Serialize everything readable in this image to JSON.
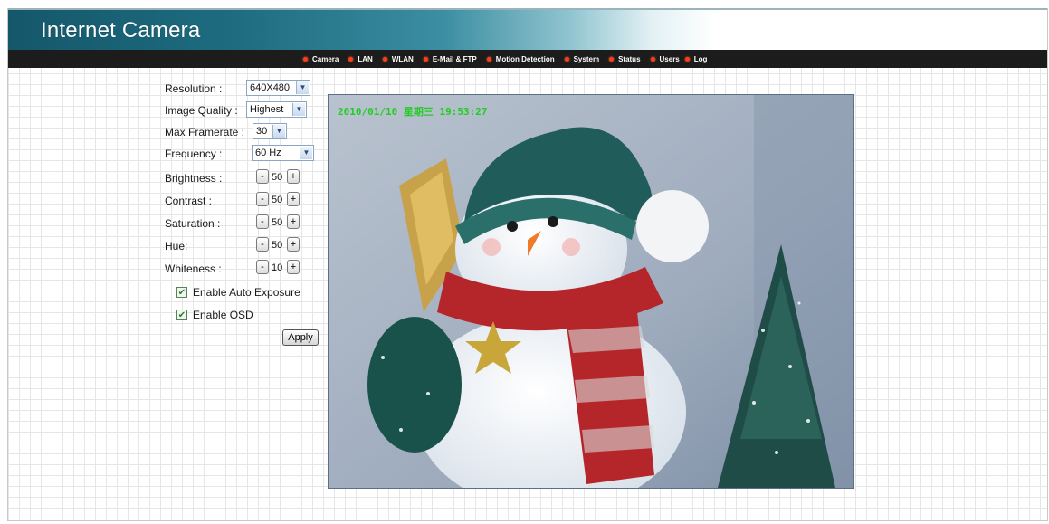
{
  "header": {
    "title": "Internet Camera"
  },
  "nav": {
    "items": [
      "Camera",
      "LAN",
      "WLAN",
      "E-Mail & FTP",
      "Motion Detection",
      "System",
      "Status",
      "Users",
      "Log"
    ]
  },
  "settings": {
    "resolution": {
      "label": "Resolution :",
      "value": "640X480"
    },
    "image_quality": {
      "label": "Image Quality :",
      "value": "Highest"
    },
    "max_framerate": {
      "label": "Max Framerate :",
      "value": "30"
    },
    "frequency": {
      "label": "Frequency :",
      "value": "60 Hz"
    },
    "brightness": {
      "label": "Brightness :",
      "value": "50"
    },
    "contrast": {
      "label": "Contrast :",
      "value": "50"
    },
    "saturation": {
      "label": "Saturation :",
      "value": "50"
    },
    "hue": {
      "label": "Hue:",
      "value": "50"
    },
    "whiteness": {
      "label": "Whiteness :",
      "value": "10"
    },
    "stepper": {
      "minus": "-",
      "plus": "+"
    },
    "auto_exposure": {
      "label": "Enable Auto Exposure",
      "checked": true
    },
    "osd": {
      "label": "Enable OSD",
      "checked": true
    },
    "apply_label": "Apply"
  },
  "video": {
    "osd_text": "2010/01/10 星期三 19:53:27"
  },
  "icons": {
    "dropdown": "chevron-down-icon",
    "checkmark": "check-icon",
    "nav_bullet": "bullet-icon"
  },
  "colors": {
    "nav_bullet": "#ff3b1a",
    "osd_text": "#22cc22",
    "nav_bar": "#1c1c1c",
    "header_dark": "#15576a"
  }
}
